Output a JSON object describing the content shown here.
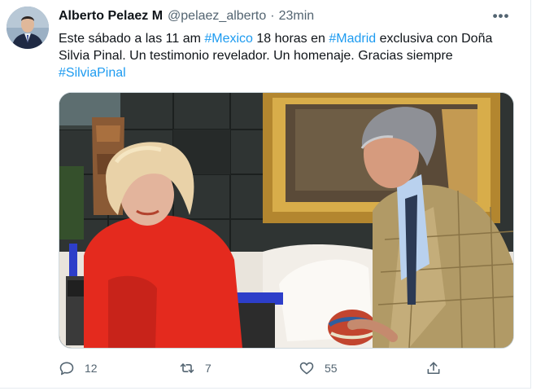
{
  "tweet": {
    "author_name": "Alberto Pelaez M",
    "author_handle": "@pelaez_alberto",
    "separator": "·",
    "time": "23min",
    "more_label": "•••",
    "text_parts": [
      "Este sábado a las 11 am ",
      "#Mexico",
      " 18 horas en ",
      "#Madrid",
      " exclusiva con Doña Silvia Pinal. Un testimonio revelador. Un homenaje. Gracias siempre ",
      "#SilviaPinal"
    ]
  },
  "actions": {
    "reply_count": "12",
    "retweet_count": "7",
    "like_count": "55"
  },
  "colors": {
    "hashtag": "#1d9bf0",
    "secondary_text": "#536471",
    "border": "#cfd9de"
  },
  "icons": [
    "reply-icon",
    "retweet-icon",
    "like-icon",
    "share-icon",
    "more-icon"
  ]
}
